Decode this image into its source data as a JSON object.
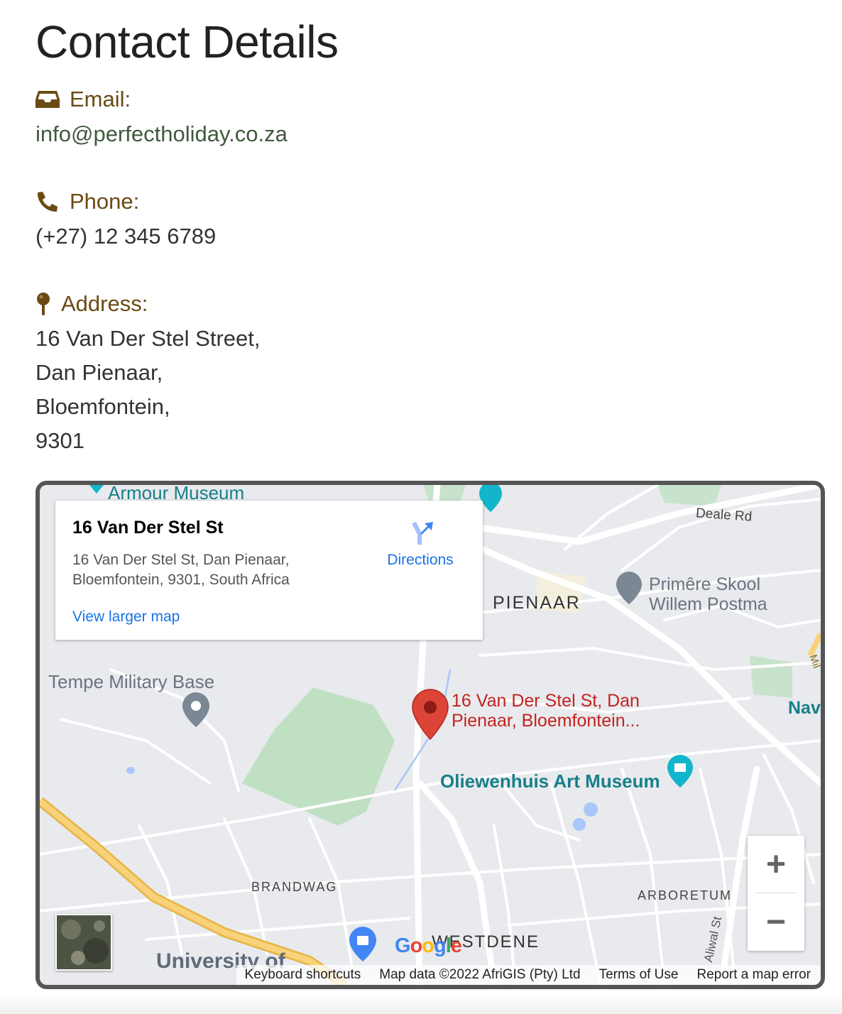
{
  "page": {
    "title": "Contact Details"
  },
  "contact": {
    "email_label": "Email:",
    "email_value": "info@perfectholiday.co.za",
    "phone_label": "Phone:",
    "phone_value": "(+27) 12 345 6789",
    "address_label": "Address:",
    "address_lines": [
      "16 Van Der Stel Street,",
      "Dan Pienaar,",
      "Bloemfontein,",
      "9301"
    ]
  },
  "map": {
    "info_title": "16 Van Der Stel St",
    "info_address_line1": "16 Van Der Stel St, Dan Pienaar,",
    "info_address_line2": "Bloemfontein, 9301, South Africa",
    "directions_label": "Directions",
    "view_larger_label": "View larger map",
    "pin_label_line1": "16 Van Der Stel St, Dan",
    "pin_label_line2": "Pienaar, Bloemfontein...",
    "places": {
      "armour_museum": "Armour Museum",
      "deale_rd": "Deale Rd",
      "pienaar": "PIENAAR",
      "school_line1": "Primêre Skool",
      "school_line2": "Willem Postma",
      "tempe": "Tempe Military Base",
      "oliewenhuis": "Oliewenhuis Art Museum",
      "nav": "Nav",
      "brandwag": "BRANDWAG",
      "arboretum": "ARBORETUM",
      "westdene": "WESTDENE",
      "aliwal": "Aliwal St",
      "university": "University of",
      "mil": "Mil"
    },
    "zoom_in": "+",
    "zoom_out": "−",
    "logo": "Google",
    "footer": {
      "shortcuts": "Keyboard shortcuts",
      "mapdata": "Map data ©2022 AfriGIS (Pty) Ltd",
      "terms": "Terms of Use",
      "report": "Report a map error"
    },
    "colors": {
      "pin": "#db4437",
      "park": "#c0e0c4",
      "road_highway": "#f6c15a",
      "accent_blue": "#1a73e8",
      "place_teal": "#177f8a"
    }
  },
  "icons": {
    "email": "inbox-icon",
    "phone": "phone-icon",
    "address": "map-pin-icon",
    "directions": "directions-icon",
    "satellite": "satellite-thumbnail"
  }
}
